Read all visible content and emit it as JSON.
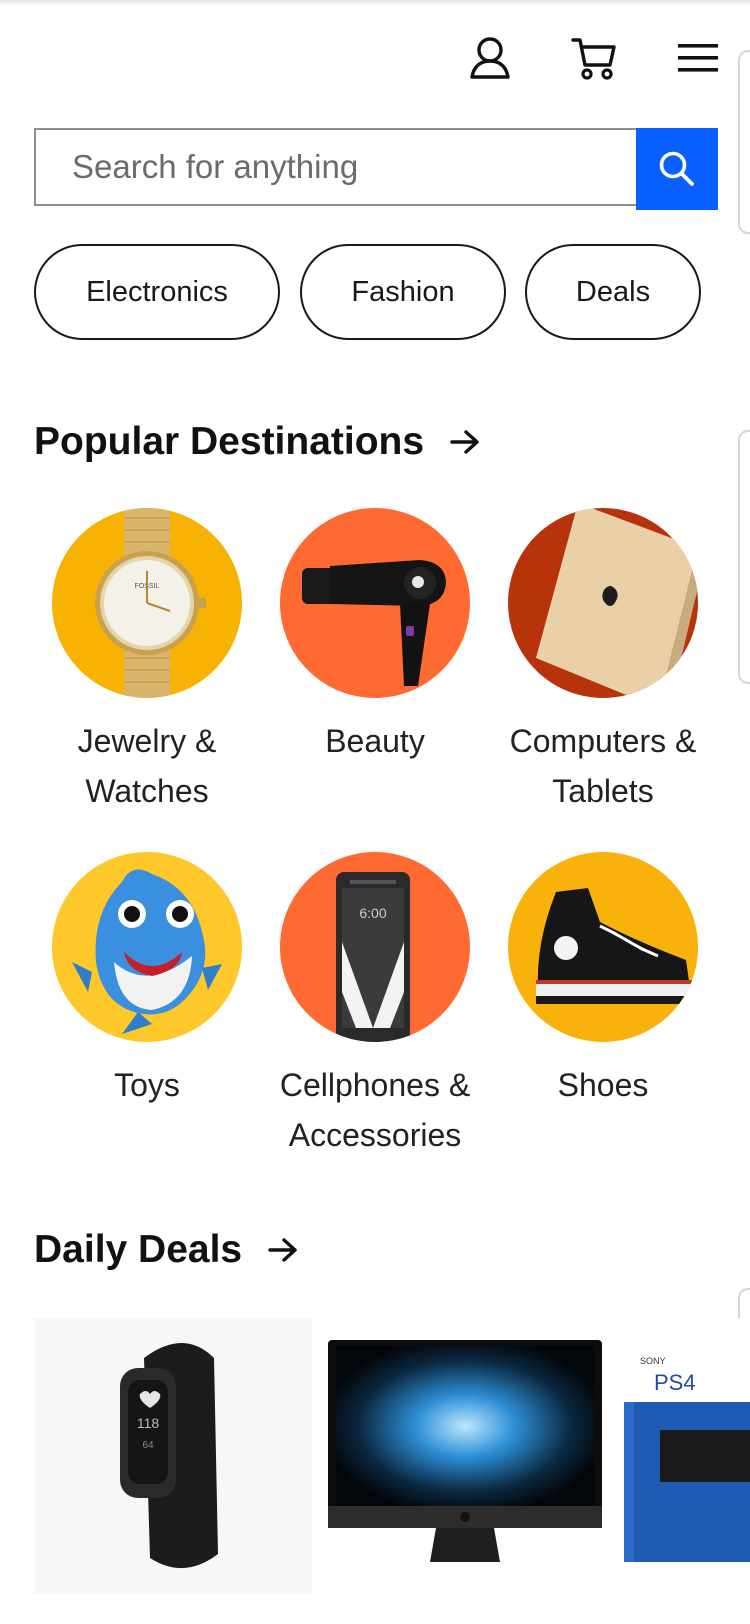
{
  "header": {
    "account_icon": "person-outline-icon",
    "cart_icon": "shopping-cart-icon",
    "menu_icon": "hamburger-menu-icon"
  },
  "search": {
    "placeholder": "Search for anything",
    "button_icon": "search-icon",
    "accent": "#0a5fff"
  },
  "pills": [
    "Electronics",
    "Fashion",
    "Deals"
  ],
  "popular": {
    "title": "Popular Destinations",
    "items": [
      {
        "line1": "Jewelry &",
        "line2": "Watches",
        "image": "gold-watch",
        "bg": "#f7b204"
      },
      {
        "line1": "Beauty",
        "line2": "",
        "image": "hair-dryer",
        "bg": "#ff6a32"
      },
      {
        "line1": "Computers &",
        "line2": "Tablets",
        "image": "laptop",
        "bg": "#b7330c"
      },
      {
        "line1": "Toys",
        "line2": "",
        "image": "plush-shark",
        "bg": "#fec82b"
      },
      {
        "line1": "Cellphones &",
        "line2": "Accessories",
        "image": "smartphone",
        "bg": "#ff6a32"
      },
      {
        "line1": "Shoes",
        "line2": "",
        "image": "high-top-sneaker",
        "bg": "#f9b20b"
      }
    ]
  },
  "deals": {
    "title": "Daily Deals",
    "items": [
      {
        "image": "fitness-tracker"
      },
      {
        "image": "desktop-monitor"
      },
      {
        "image": "game-console-box"
      }
    ]
  }
}
